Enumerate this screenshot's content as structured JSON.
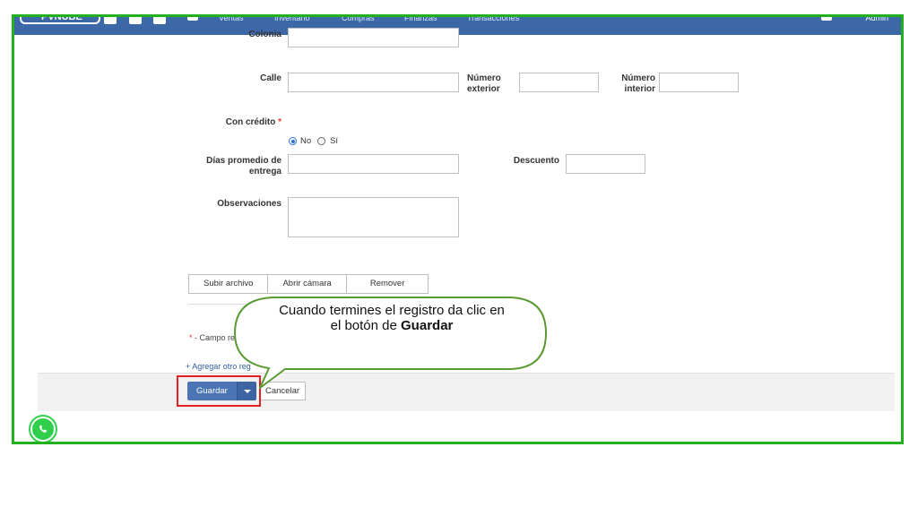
{
  "header": {
    "logo": "PVNUBE",
    "menu": [
      "Ventas",
      "Inventario",
      "Compras",
      "Finanzas",
      "Transacciones"
    ],
    "user": "Admin"
  },
  "form": {
    "colonia_label": "Colonia",
    "calle_label": "Calle",
    "numero_exterior_label": "Número exterior",
    "numero_interior_label": "Número interior",
    "con_credito_label": "Con crédito",
    "required_mark": "*",
    "credito_options": [
      {
        "label": "No",
        "selected": true
      },
      {
        "label": "Sí",
        "selected": false
      }
    ],
    "dias_label": "Días promedio de entrega",
    "descuento_label": "Descuento",
    "observaciones_label": "Observaciones"
  },
  "file_buttons": {
    "upload": "Subir archivo",
    "camera": "Abrir cámara",
    "remove": "Remover"
  },
  "note": {
    "asterisk": "*",
    "text": " - Campo re"
  },
  "add_link": "+ Agregar otro reg",
  "footer": {
    "save": "Guardar",
    "cancel": "Cancelar"
  },
  "callout": {
    "line1": "Cuando termines el registro da clic en",
    "line2_prefix": "el botón de ",
    "line2_bold": "Guardar"
  },
  "colors": {
    "frame": "#22b01f",
    "topbar": "#3d68a8",
    "primary_button": "#4a74b4",
    "highlight": "#e41f25",
    "callout_border": "#5a9a32",
    "whatsapp": "#2fcf4c"
  }
}
